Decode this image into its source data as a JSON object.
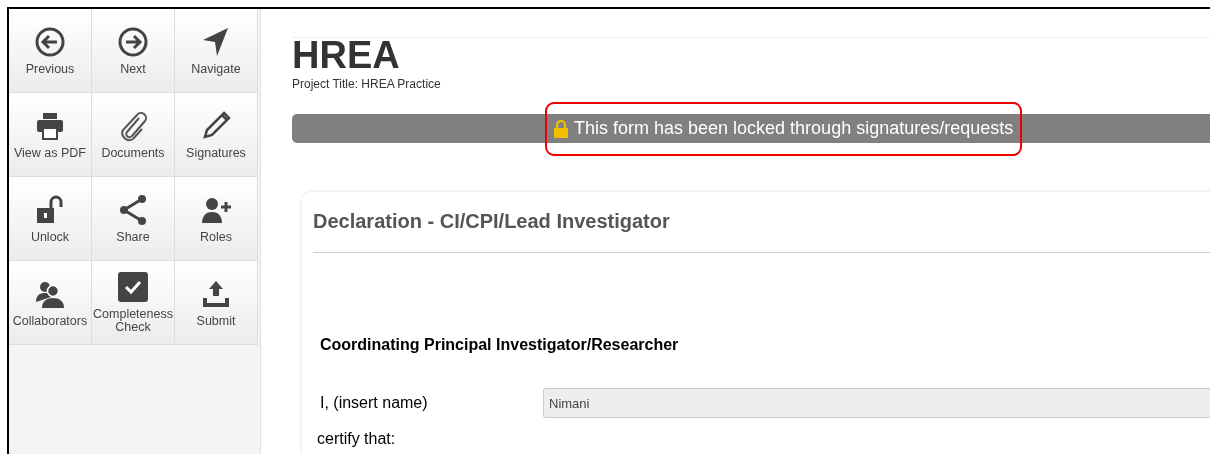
{
  "sidebar": {
    "buttons": [
      {
        "kind": "previous",
        "label": "Previous"
      },
      {
        "kind": "next",
        "label": "Next"
      },
      {
        "kind": "navigate",
        "label": "Navigate"
      },
      {
        "kind": "pdf",
        "label": "View as PDF"
      },
      {
        "kind": "documents",
        "label": "Documents"
      },
      {
        "kind": "signatures",
        "label": "Signatures"
      },
      {
        "kind": "unlock",
        "label": "Unlock"
      },
      {
        "kind": "share",
        "label": "Share"
      },
      {
        "kind": "roles",
        "label": "Roles"
      },
      {
        "kind": "collaborators",
        "label": "Collaborators"
      },
      {
        "kind": "check",
        "label": "Completeness Check"
      },
      {
        "kind": "submit",
        "label": "Submit"
      }
    ]
  },
  "header": {
    "title": "HREA",
    "project": "Project Title: HREA Practice"
  },
  "banner": {
    "text": "This form has been locked through signatures/requests",
    "highlighted": true
  },
  "form": {
    "heading": "Declaration - CI/CPI/Lead Investigator",
    "section": "Coordinating Principal Investigator/Researcher",
    "name_label": "I, (insert name)",
    "name_value": "Nimani",
    "certify": "certify that:"
  }
}
